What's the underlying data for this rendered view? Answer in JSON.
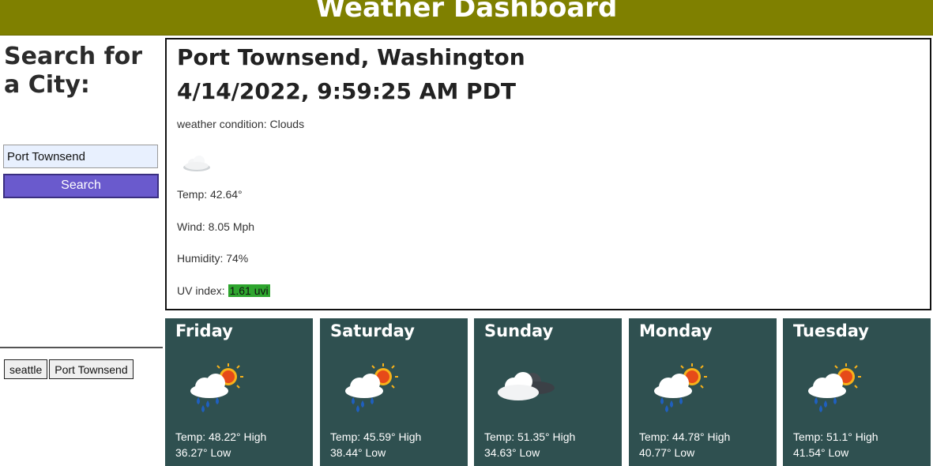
{
  "header": {
    "title": "Weather Dashboard"
  },
  "search": {
    "label": "Search for a City:",
    "input_value": "Port Townsend",
    "button_label": "Search"
  },
  "history": [
    "seattle",
    "Port Townsend"
  ],
  "current": {
    "city": "Port Townsend, Washington",
    "datetime": "4/14/2022, 9:59:25 AM PDT",
    "condition": "weather condition: Clouds",
    "icon": "cloud-icon",
    "temp": "Temp: 42.64°",
    "wind": "Wind: 8.05 Mph",
    "humidity": "Humidity: 74%",
    "uv_label": "UV index: ",
    "uv_value": "1.61 uvi",
    "uv_color": "#2ea52e"
  },
  "forecast": [
    {
      "day": "Friday",
      "icon": "rain-sun-cloud-icon",
      "temp_high": "Temp: 48.22° High",
      "temp_low": "36.27° Low"
    },
    {
      "day": "Saturday",
      "icon": "rain-sun-cloud-icon",
      "temp_high": "Temp: 45.59° High",
      "temp_low": "38.44° Low"
    },
    {
      "day": "Sunday",
      "icon": "cloud-dark-icon",
      "temp_high": "Temp: 51.35° High",
      "temp_low": "34.63° Low"
    },
    {
      "day": "Monday",
      "icon": "rain-sun-cloud-icon",
      "temp_high": "Temp: 44.78° High",
      "temp_low": "40.77° Low"
    },
    {
      "day": "Tuesday",
      "icon": "rain-sun-cloud-icon",
      "temp_high": "Temp: 51.1° High",
      "temp_low": "41.54° Low"
    }
  ],
  "colors": {
    "header_bg": "#7f8000",
    "button_bg": "#6a5acd",
    "forecast_bg": "#2f5050"
  }
}
